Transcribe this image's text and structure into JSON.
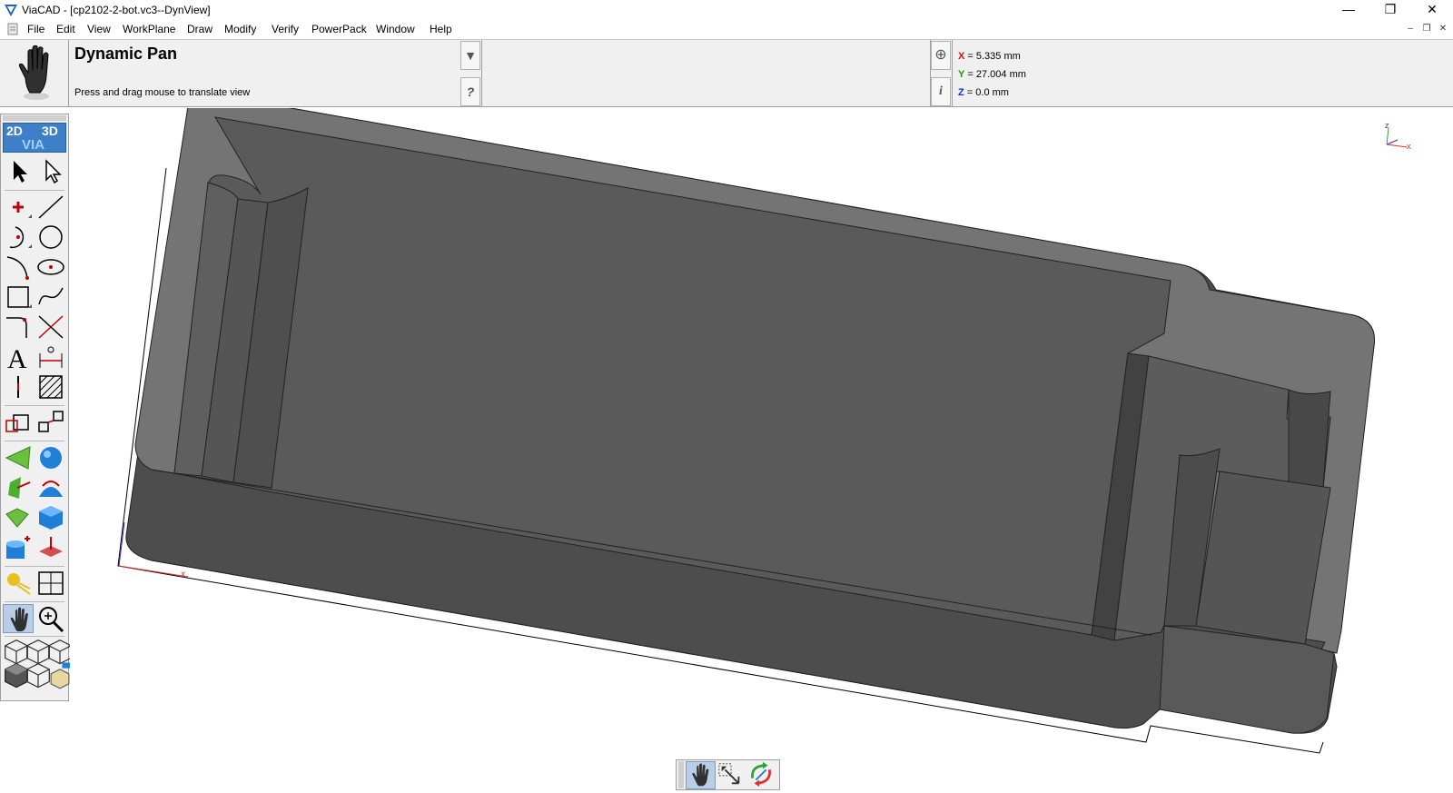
{
  "window": {
    "title": "ViaCAD - [cp2102-2-bot.vc3--DynView]",
    "minimize_glyph": "—",
    "restore_glyph": "❐",
    "close_glyph": "✕"
  },
  "menu": {
    "items": [
      "File",
      "Edit",
      "View",
      "WorkPlane",
      "Draw",
      "Modify",
      "Verify",
      "PowerPack",
      "Window",
      "Help"
    ],
    "mdi_minimize": "–",
    "mdi_restore": "❐",
    "mdi_close": "✕"
  },
  "command": {
    "icon": "hand-icon",
    "title": "Dynamic Pan",
    "prompt": "Press and drag mouse to translate view",
    "dropdown_glyph": "▼",
    "help_glyph": "?",
    "snap_glyph": "⊕",
    "info_glyph": "i"
  },
  "coordinates": {
    "x_axis": "X",
    "x_value": " = 5.335 mm",
    "y_axis": "Y",
    "y_value": " = 27.004 mm",
    "z_axis": "Z",
    "z_value": " = 0.0 mm",
    "colors": {
      "x": "#d01010",
      "y": "#10a010",
      "z": "#1030d0"
    }
  },
  "toolbox": {
    "logo_2d": "2D",
    "logo_3d": "3D",
    "logo_via": "VIA",
    "tools": [
      "select-arrow-icon",
      "select-hollow-arrow-icon",
      "point-icon",
      "line-icon",
      "arc-icon",
      "circle-icon",
      "curve-arc-icon",
      "ellipse-icon",
      "rectangle-icon",
      "spline-icon",
      "fillet-icon",
      "trim-icon",
      "text-icon",
      "dimension-icon",
      "centerline-icon",
      "hatch-icon",
      "transform-icon",
      "copy-icon",
      "cone-solid-icon",
      "sphere-solid-icon",
      "extrude-icon",
      "revolve-icon",
      "loft-icon",
      "box-solid-icon",
      "boolean-icon",
      "push-pull-icon",
      "render-light-icon",
      "layout-icon",
      "pan-hand-icon",
      "zoom-icon",
      "iso-view-1-icon",
      "iso-view-2-icon",
      "iso-view-3-icon",
      "shaded-view-icon",
      "wireframe-view-icon",
      "view-cube-icon"
    ]
  },
  "viewport": {
    "triad_x": "x",
    "triad_z": "z",
    "axis_x_label": "x",
    "model_color": "#5a5a5a",
    "top_face_color": "#777777"
  },
  "navbar": {
    "tools": [
      "pan-hand-icon",
      "zoom-window-icon",
      "rotate-view-icon"
    ]
  }
}
